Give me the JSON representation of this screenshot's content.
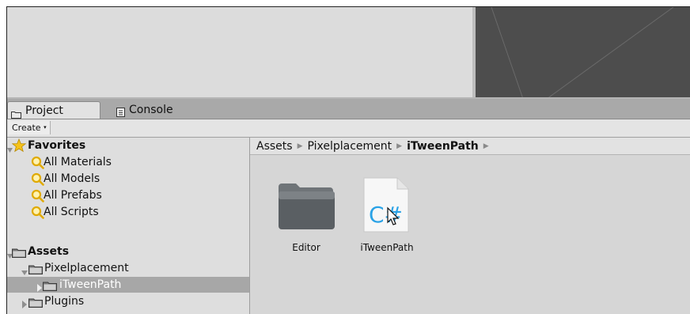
{
  "tabs": {
    "project": "Project",
    "console": "Console"
  },
  "toolbar": {
    "create": "Create",
    "create_arrow": "▾"
  },
  "favorites": {
    "header": "Favorites",
    "items": [
      "All Materials",
      "All Models",
      "All Prefabs",
      "All Scripts"
    ]
  },
  "assets_tree": {
    "header": "Assets",
    "pixelplacement": "Pixelplacement",
    "itweenpath": "iTweenPath",
    "plugins": "Plugins"
  },
  "breadcrumb": {
    "items": [
      "Assets",
      "Pixelplacement",
      "iTweenPath"
    ],
    "separator": "▶"
  },
  "assets_view": {
    "items": [
      {
        "label": "Editor",
        "icon": "folder-icon"
      },
      {
        "label": "iTweenPath",
        "icon": "csharp-script-icon"
      }
    ]
  },
  "colors": {
    "selected_row": "#a7a7a7",
    "favorite_star": "#f5c21b",
    "search_icon": "#e8b400",
    "script_accent": "#2aa2e6"
  }
}
